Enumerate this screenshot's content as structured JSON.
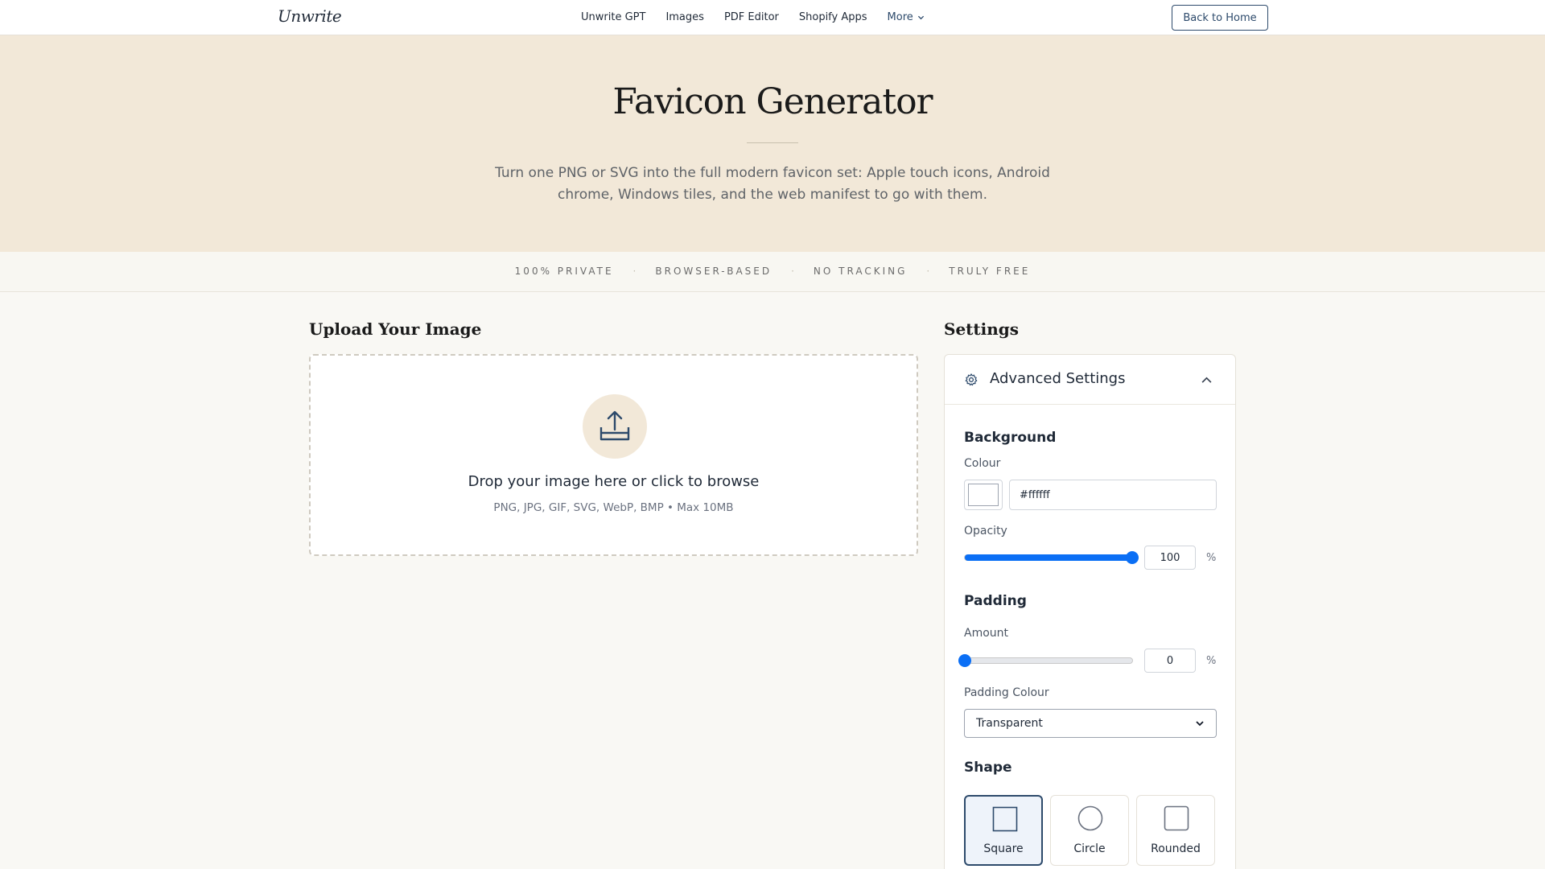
{
  "nav": {
    "brand": "Unwrite",
    "links": [
      "Unwrite GPT",
      "Images",
      "PDF Editor",
      "Shopify Apps"
    ],
    "more_label": "More",
    "back_button": "Back to Home"
  },
  "hero": {
    "title": "Favicon Generator",
    "subtitle": "Turn one PNG or SVG into the full modern favicon set: Apple touch icons, Android chrome, Windows tiles, and the web manifest to go with them."
  },
  "trust": {
    "items": [
      "100% PRIVATE",
      "BROWSER-BASED",
      "NO TRACKING",
      "TRULY FREE"
    ],
    "separator": "·"
  },
  "upload": {
    "heading": "Upload Your Image",
    "drop_text": "Drop your image here or click to browse",
    "formats": "PNG, JPG, GIF, SVG, WebP, BMP • Max 10MB"
  },
  "settings": {
    "heading": "Settings",
    "panel_title": "Advanced Settings",
    "background": {
      "title": "Background",
      "colour_label": "Colour",
      "colour_value": "#ffffff",
      "opacity_label": "Opacity",
      "opacity_value": "100",
      "opacity_unit": "%",
      "opacity_fraction": 1.0
    },
    "padding": {
      "title": "Padding",
      "amount_label": "Amount",
      "amount_value": "0",
      "amount_unit": "%",
      "amount_fraction": 0.0,
      "colour_label": "Padding Colour",
      "colour_selected": "Transparent"
    },
    "shape": {
      "title": "Shape",
      "options": [
        "Square",
        "Circle",
        "Rounded"
      ],
      "selected": "Square"
    }
  },
  "colors": {
    "accent": "#2d4a6b",
    "slider": "#0b6ff5",
    "hero_bg": "#f2e8d8",
    "page_bg": "#f9f8f4"
  },
  "icons": {
    "upload": "upload-tray-icon",
    "settings": "gear-icon",
    "collapse": "chevron-up-icon",
    "more": "chevron-down-icon",
    "select": "chevron-down-icon"
  }
}
